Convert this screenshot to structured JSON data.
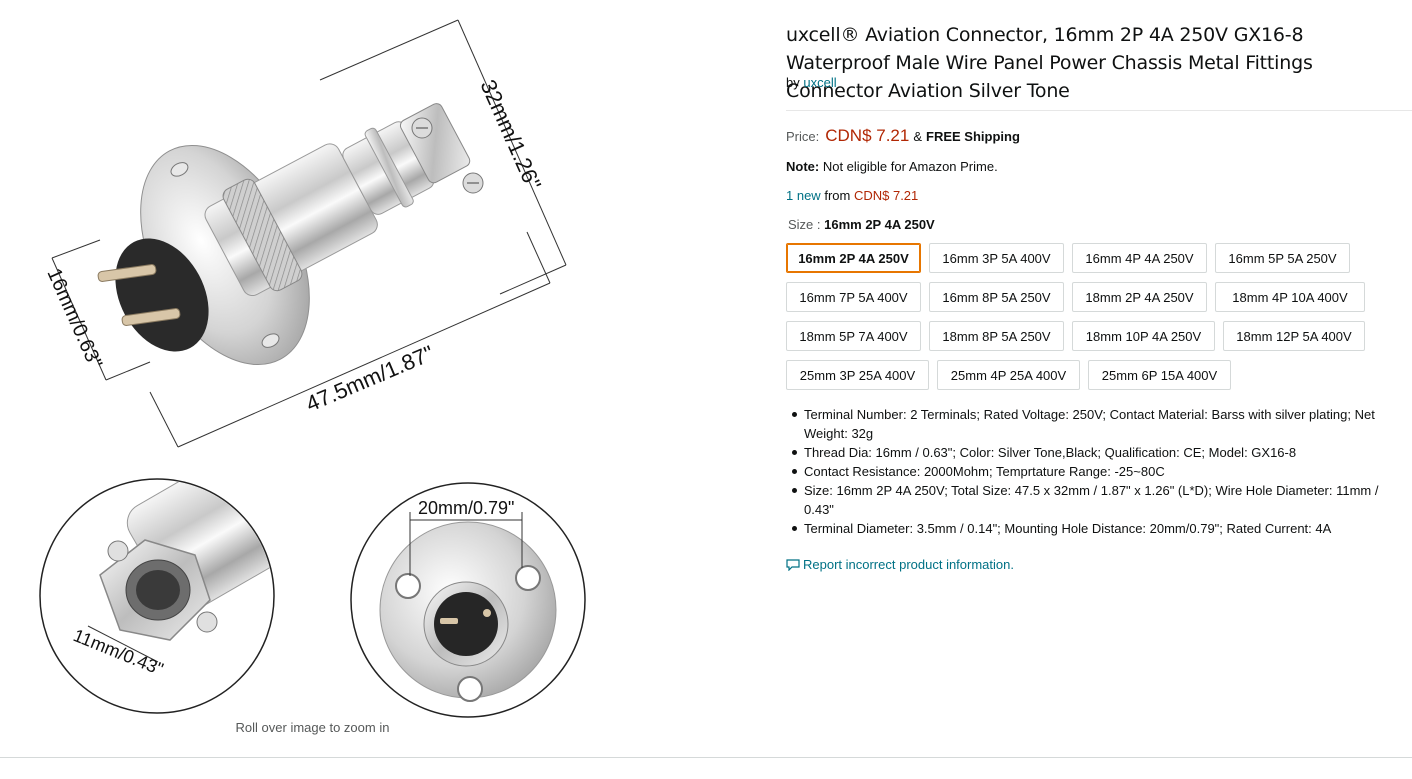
{
  "image": {
    "dim_length": "47.5mm/1.87\"",
    "dim_diameter": "32mm/1.26\"",
    "dim_thread": "16mm/0.63\"",
    "dim_hole": "11mm/0.43\"",
    "dim_mount": "20mm/0.79\"",
    "zoom_hint": "Roll over image to zoom in"
  },
  "product": {
    "title": "uxcell® Aviation Connector, 16mm 2P 4A 250V GX16-8 Waterproof Male Wire Panel Power Chassis Metal Fittings Connector Aviation Silver Tone",
    "by_label": "by",
    "brand": "uxcell"
  },
  "price": {
    "label": "Price:",
    "value": "CDN$ 7.21",
    "amp": "&",
    "shipping": "FREE Shipping"
  },
  "note": {
    "label": "Note:",
    "text": "Not eligible for Amazon Prime."
  },
  "offers": {
    "link": "1 new",
    "from": "from",
    "price": "CDN$ 7.21"
  },
  "size": {
    "label": "Size :",
    "selected": "16mm 2P 4A 250V",
    "rows": [
      [
        "16mm 2P 4A 250V",
        "16mm 3P 5A 400V",
        "16mm 4P 4A 250V",
        "16mm 5P 5A 250V"
      ],
      [
        "16mm 7P 5A 400V",
        "16mm 8P 5A 250V",
        "18mm 2P 4A 250V",
        "18mm 4P 10A 400V"
      ],
      [
        "18mm 5P 7A 400V",
        "18mm 8P 5A 250V",
        "18mm 10P 4A 250V",
        "18mm 12P 5A 400V"
      ],
      [
        "25mm 3P 25A 400V",
        "25mm 4P 25A 400V",
        "25mm 6P 15A 400V"
      ]
    ]
  },
  "bullets": [
    "Terminal Number: 2 Terminals; Rated Voltage: 250V; Contact Material: Barss with silver plating; Net Weight: 32g",
    "Thread Dia: 16mm / 0.63\"; Color: Silver Tone,Black; Qualification: CE; Model: GX16-8",
    "Contact Resistance: 2000Mohm; Temprtature Range: -25~80C",
    "Size: 16mm 2P 4A 250V; Total Size: 47.5 x 32mm / 1.87\" x 1.26\" (L*D); Wire Hole Diameter: 11mm / 0.43\"",
    "Terminal Diameter: 3.5mm / 0.14\"; Mounting Hole Distance: 20mm/0.79\"; Rated Current: 4A"
  ],
  "report": {
    "icon": "comment-icon",
    "text": "Report incorrect product information."
  },
  "colors": {
    "link": "#007185",
    "price": "#b12704",
    "selected_border": "#e77600"
  }
}
